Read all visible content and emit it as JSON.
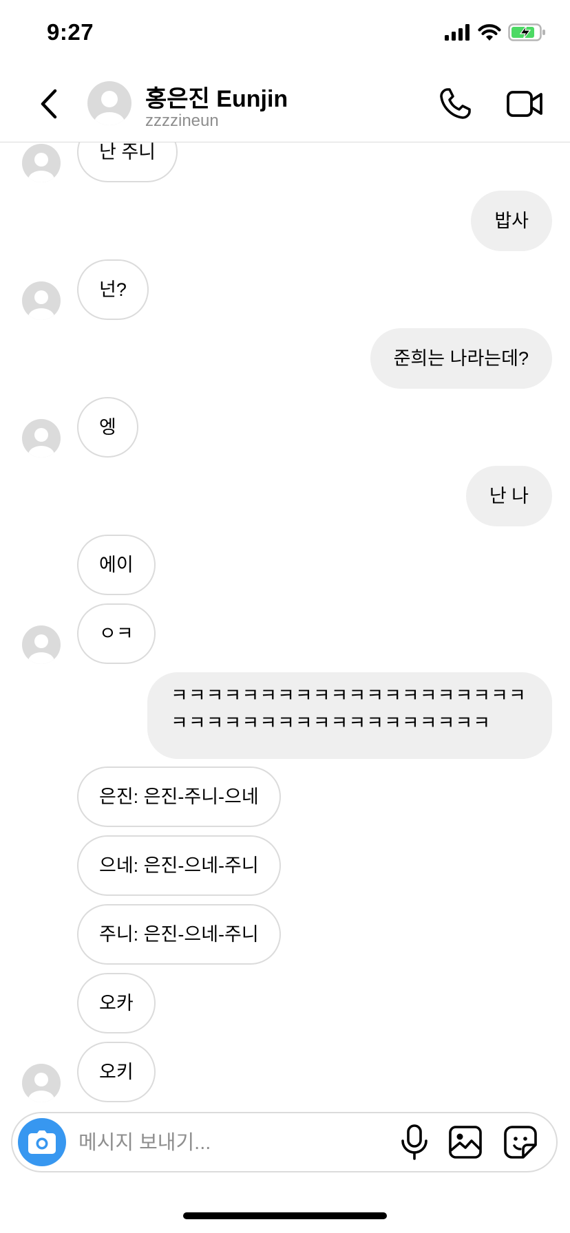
{
  "status_bar": {
    "time": "9:27"
  },
  "header": {
    "name": "홍은진 Eunjin",
    "username": "zzzzineun"
  },
  "messages": [
    {
      "text": "난 주니"
    },
    {
      "text": "밥사"
    },
    {
      "text": "넌?"
    },
    {
      "text": "준희는 나라는데?"
    },
    {
      "text": "엥"
    },
    {
      "text": "난 나"
    },
    {
      "text": "에이"
    },
    {
      "text": "ㅇㅋ"
    },
    {
      "text": "ㅋㅋㅋㅋㅋㅋㅋㅋㅋㅋㅋㅋㅋㅋㅋㅋㅋㅋㅋㅋㅋㅋㅋㅋㅋㅋㅋㅋㅋㅋㅋㅋㅋㅋㅋㅋㅋㅋ"
    },
    {
      "text": "은진: 은진-주니-으네"
    },
    {
      "text": "으네: 은진-으네-주니"
    },
    {
      "text": "주니: 은진-으네-주니"
    },
    {
      "text": "오카"
    },
    {
      "text": "오키"
    }
  ],
  "composer": {
    "placeholder": "메시지 보내기..."
  },
  "colors": {
    "accent": "#3797f0",
    "outgoing_bubble": "#efefef",
    "border": "#dbdbdb",
    "battery": "#4cd964"
  }
}
